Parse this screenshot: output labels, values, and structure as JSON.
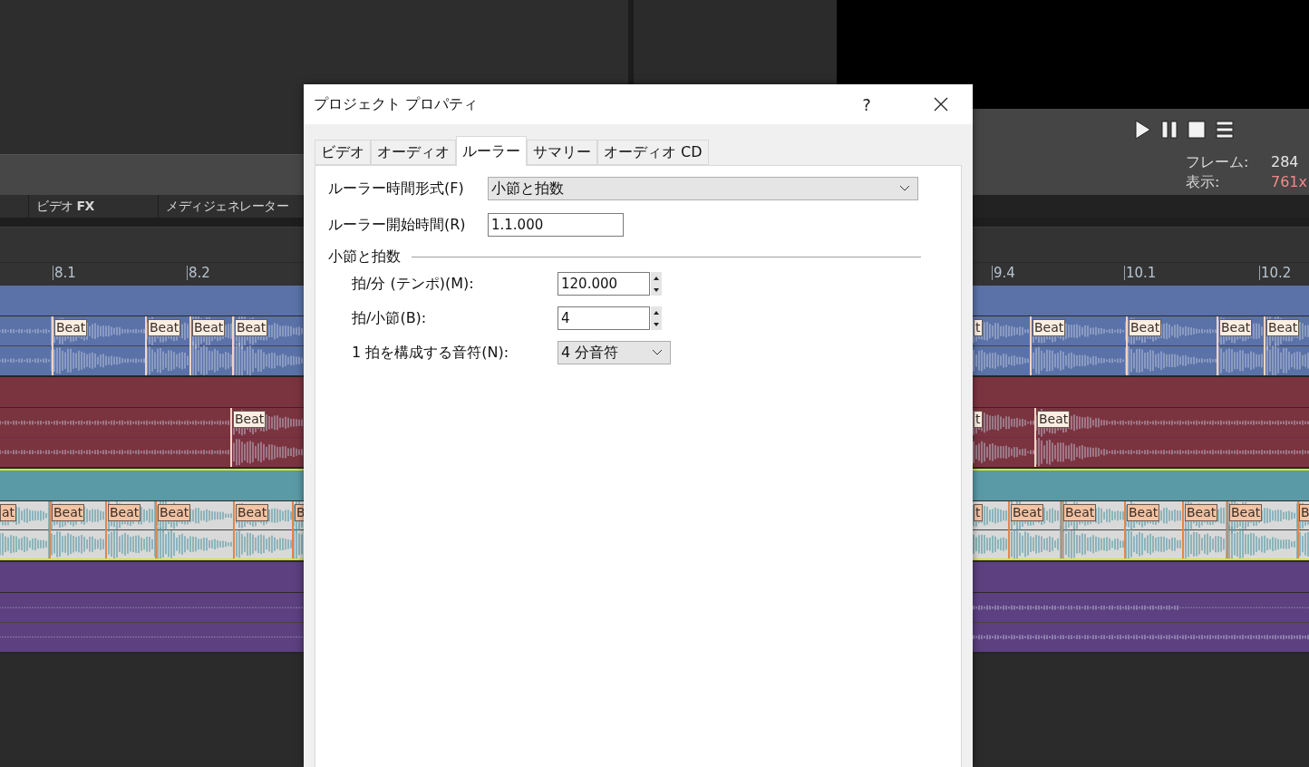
{
  "docked_tabs": [
    {
      "label": "ビデオ **FX**"
    },
    {
      "label": "メディジェネレーター"
    }
  ],
  "preview": {
    "frame_label": "フレーム:",
    "frame_value": "284",
    "display_label": "表示:",
    "display_value": "761x"
  },
  "ruler": [
    "8.1",
    "8.2",
    "9.4",
    "10.1",
    "10.2"
  ],
  "tracks": [
    {
      "color": "#5a72a8",
      "selected": false,
      "markers": [
        "Beat",
        "Beat",
        "Beat",
        "Beat",
        "t",
        "Beat",
        "Beat",
        "Beat",
        "Beat"
      ]
    },
    {
      "color": "#7a3440",
      "selected": false,
      "markers": [
        "Beat",
        "t",
        "Beat"
      ]
    },
    {
      "color": "#5a9aa6",
      "selected": true,
      "markers": [
        "at",
        "Beat",
        "Beat",
        "Beat",
        "Beat",
        "B",
        "t",
        "Beat",
        "Beat",
        "Beat",
        "Beat",
        "Beat",
        "B"
      ]
    },
    {
      "color": "#5c4080",
      "selected": false
    }
  ],
  "dialog": {
    "title": "プロジェクト プロパティ",
    "help": "?",
    "tabs": [
      {
        "label": "ビデオ",
        "selected": false
      },
      {
        "label": "オーディオ",
        "selected": false
      },
      {
        "label": "ルーラー",
        "selected": true
      },
      {
        "label": "サマリー",
        "selected": false
      },
      {
        "label": "オーディオ CD",
        "selected": false
      }
    ],
    "fields": [
      {
        "kind": "select",
        "label": "ルーラー時間形式(F)",
        "value": "小節と拍数"
      },
      {
        "kind": "text",
        "label": "ルーラー開始時間(R)",
        "value": "1.1.000"
      }
    ],
    "group": {
      "title": "小節と拍数",
      "fields": [
        {
          "kind": "spin",
          "label": "拍/分 (テンポ)(M):",
          "value": "120.000"
        },
        {
          "kind": "spin",
          "label": "拍/小節(B):",
          "value": "4"
        },
        {
          "kind": "select",
          "label": "1 拍を構成する音符(N):",
          "value": "4 分音符"
        }
      ]
    }
  }
}
